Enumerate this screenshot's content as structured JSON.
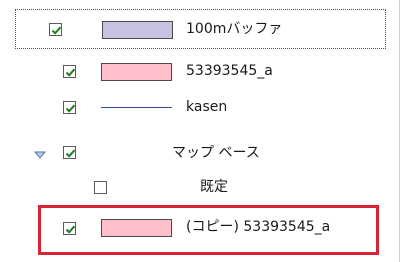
{
  "layers": [
    {
      "label": "100mバッファ",
      "checked": true,
      "symbol": "fill",
      "fill_color": "#c6c3e2",
      "outline_color": "#4a4a4a",
      "selected": true
    },
    {
      "label": "53393545_a",
      "checked": true,
      "symbol": "fill",
      "fill_color": "#ffc0cb",
      "outline_color": "#4a4a4a"
    },
    {
      "label": "kasen",
      "checked": true,
      "symbol": "line",
      "line_color": "#2e4f9e"
    },
    {
      "label": "マップ ベース",
      "checked": true,
      "symbol": "group",
      "expanded": true
    },
    {
      "label": "既定",
      "checked": false,
      "symbol": "none"
    },
    {
      "label": "(コピー) 53393545_a",
      "checked": true,
      "symbol": "fill",
      "fill_color": "#ffc0cb",
      "outline_color": "#4a4a4a",
      "highlighted": true
    }
  ],
  "colors": {
    "check_mark": "#1e7d22",
    "highlight_border": "#d62434",
    "expander_arrow": "#5c7fa8"
  }
}
